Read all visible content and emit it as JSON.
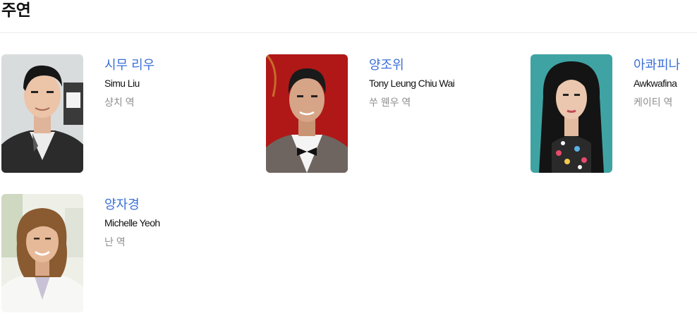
{
  "section": {
    "title": "주연"
  },
  "cast": [
    {
      "name_ko": "시무 리우",
      "name_en": "Simu Liu",
      "role": "샹치 역",
      "photo_bg": "#d9dcdd"
    },
    {
      "name_ko": "양조위",
      "name_en": "Tony Leung Chiu Wai",
      "role": "쑤 웬우 역",
      "photo_bg": "#b01818"
    },
    {
      "name_ko": "아콰피나",
      "name_en": "Awkwafina",
      "role": "케이티 역",
      "photo_bg": "#3fa3a3"
    },
    {
      "name_ko": "양자경",
      "name_en": "Michelle Yeoh",
      "role": "난 역",
      "photo_bg": "#eef0e8"
    }
  ],
  "colors": {
    "name_link": "#3a6fd8",
    "role_text": "#8e8e8e",
    "divider": "#ebebeb"
  }
}
